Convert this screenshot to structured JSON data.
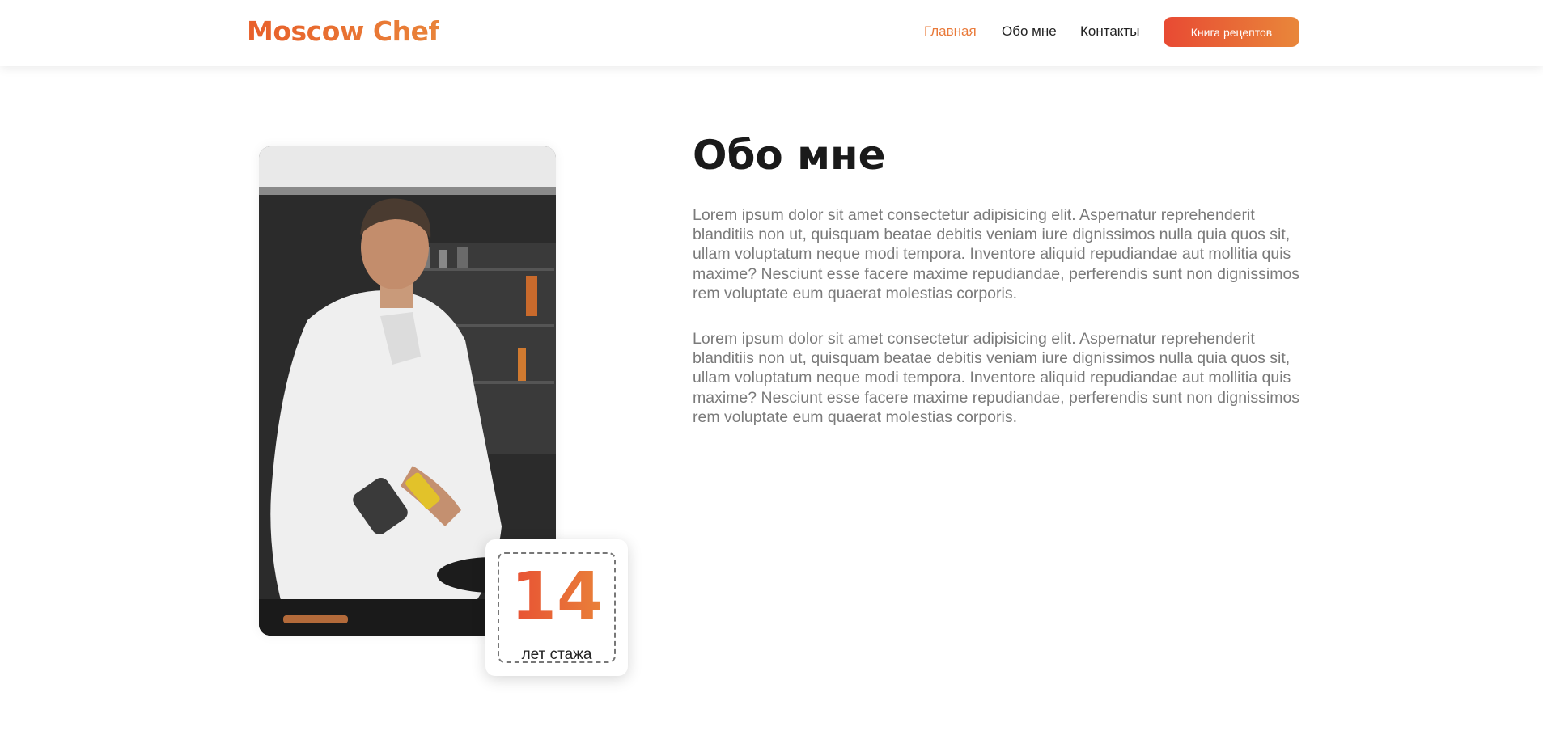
{
  "header": {
    "logo": "Moscow Chef",
    "nav": [
      {
        "label": "Главная",
        "active": true
      },
      {
        "label": "Обо мне",
        "active": false
      },
      {
        "label": "Контакты",
        "active": false
      }
    ],
    "cta_label": "Книга рецептов"
  },
  "about": {
    "title": "Обо мне",
    "paragraphs": [
      "Lorem ipsum dolor sit amet consectetur adipisicing elit. Aspernatur reprehenderit blanditiis non ut, quisquam beatae debitis veniam iure dignissimos nulla quia quos sit, ullam voluptatum neque modi tempora. Inventore aliquid repudiandae aut mollitia quis maxime? Nesciunt esse facere maxime repudiandae, perferendis sunt non dignissimos rem voluptate eum quaerat molestias corporis.",
      "Lorem ipsum dolor sit amet consectetur adipisicing elit. Aspernatur reprehenderit blanditiis non ut, quisquam beatae debitis veniam iure dignissimos nulla quia quos sit, ullam voluptatum neque modi tempora. Inventore aliquid repudiandae aut mollitia quis maxime? Nesciunt esse facere maxime repudiandae, perferendis sunt non dignissimos rem voluptate eum quaerat molestias corporis."
    ],
    "experience": {
      "number": "14",
      "label": "лет стажа"
    }
  },
  "colors": {
    "accent_start": "#e84a33",
    "accent_end": "#e9873a",
    "nav_active": "#e97a3a",
    "text_dark": "#1a1a1a",
    "text_muted": "#7a7a7a"
  }
}
